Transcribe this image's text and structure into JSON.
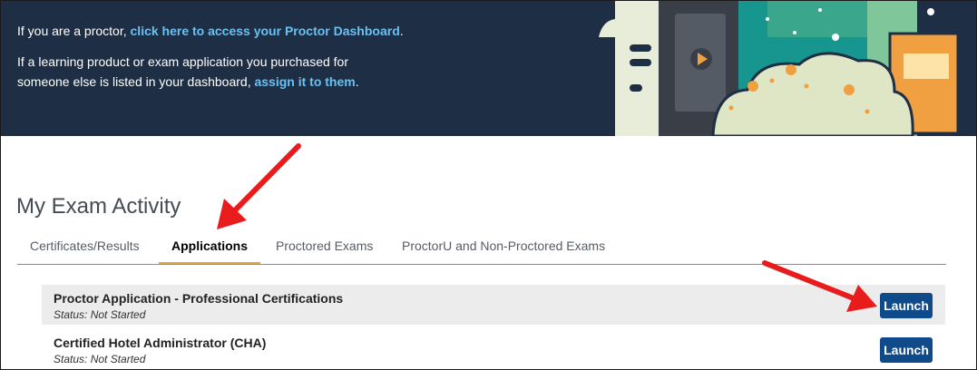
{
  "banner": {
    "proctor_prefix": "If you are a proctor,",
    "proctor_link": "click here to access your Proctor Dashboard",
    "proctor_suffix": ".",
    "assign_line1": "If a learning product or exam application you purchased for",
    "assign_prefix": "someone else is listed in your dashboard,",
    "assign_link": "assign it to them",
    "assign_suffix": "."
  },
  "activity": {
    "title": "My Exam Activity",
    "tabs": [
      {
        "label": "Certificates/Results",
        "active": false
      },
      {
        "label": "Applications",
        "active": true
      },
      {
        "label": "Proctored Exams",
        "active": false
      },
      {
        "label": "ProctorU and Non-Proctored Exams",
        "active": false
      }
    ],
    "rows": [
      {
        "title": "Proctor Application - Professional Certifications",
        "status": "Status: Not Started",
        "button": "Launch"
      },
      {
        "title": "Certified Hotel Administrator (CHA)",
        "status": "Status: Not Started",
        "button": "Launch"
      }
    ]
  },
  "colors": {
    "banner_bg": "#1d2e45",
    "link": "#6cc0f0",
    "button": "#0f4a8a",
    "tab_underline": "#e0a84a",
    "annotation_arrow": "#e81c1c"
  },
  "icons": [
    "play-icon"
  ]
}
